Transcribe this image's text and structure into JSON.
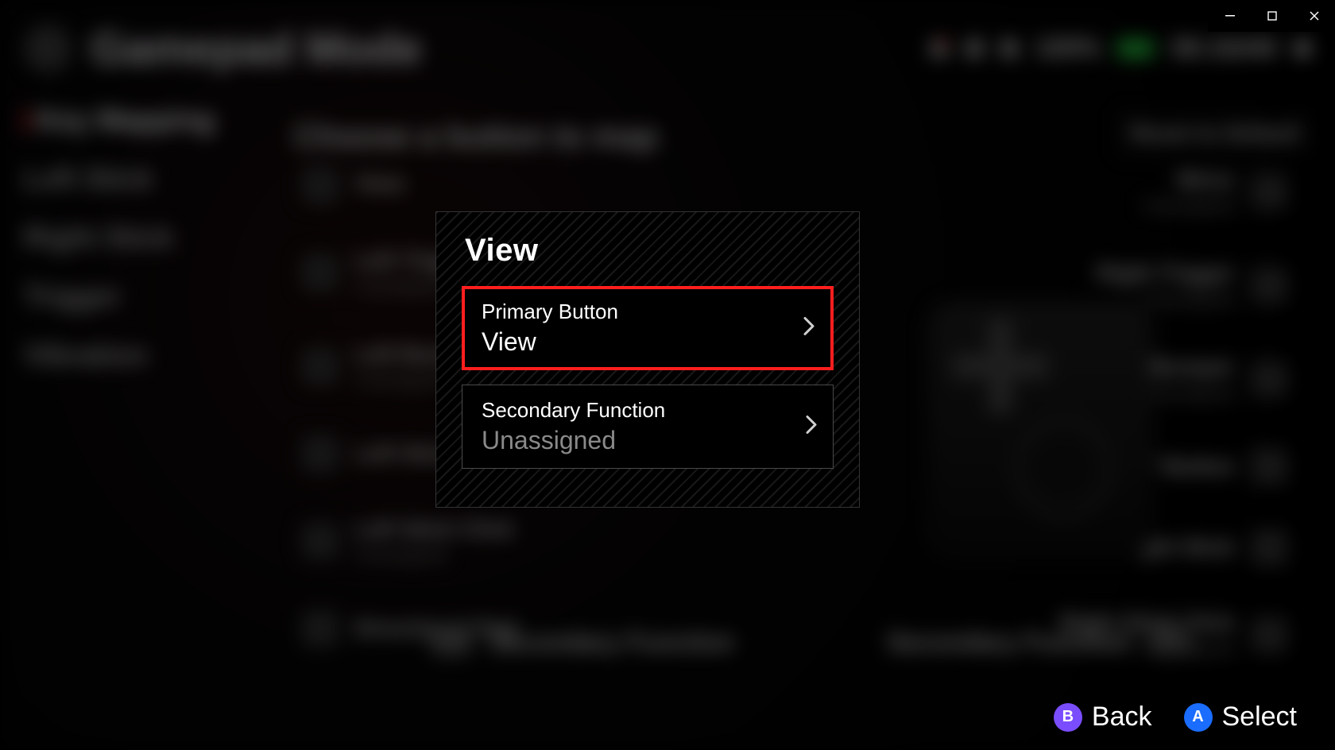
{
  "window": {
    "minimize_glyph": "─",
    "maximize_glyph": "▢",
    "close_glyph": "✕"
  },
  "topbar": {
    "title": "Gamepad Mode",
    "battery_percent": "100%",
    "time": "06:16AM"
  },
  "sidebar": {
    "items": [
      "Key Mapping",
      "Left Stick",
      "Right Stick",
      "Trigger",
      "Vibration"
    ],
    "active_index": 0
  },
  "main": {
    "heading": "Choose a button to map",
    "reset_label": "Reset to Default",
    "unassigned_text": "Unassigned",
    "left_inputs": [
      "View",
      "Left Trigger",
      "Left Bumper",
      "Left Stick",
      "Left Stick Click",
      "Directional Pad"
    ],
    "right_inputs": [
      "Menu",
      "Right Trigger",
      "Right Bumper",
      "ABXY Button",
      "Right Stick",
      "Right Stick Click"
    ],
    "secondary_function_label": "Secondary Function"
  },
  "modal": {
    "title": "View",
    "options": [
      {
        "label": "Primary Button",
        "value": "View",
        "dim": false,
        "selected": true
      },
      {
        "label": "Secondary Function",
        "value": "Unassigned",
        "dim": true,
        "selected": false
      }
    ]
  },
  "footer": {
    "hints": [
      {
        "btn": "B",
        "label": "Back",
        "color": "b"
      },
      {
        "btn": "A",
        "label": "Select",
        "color": "a"
      }
    ]
  }
}
